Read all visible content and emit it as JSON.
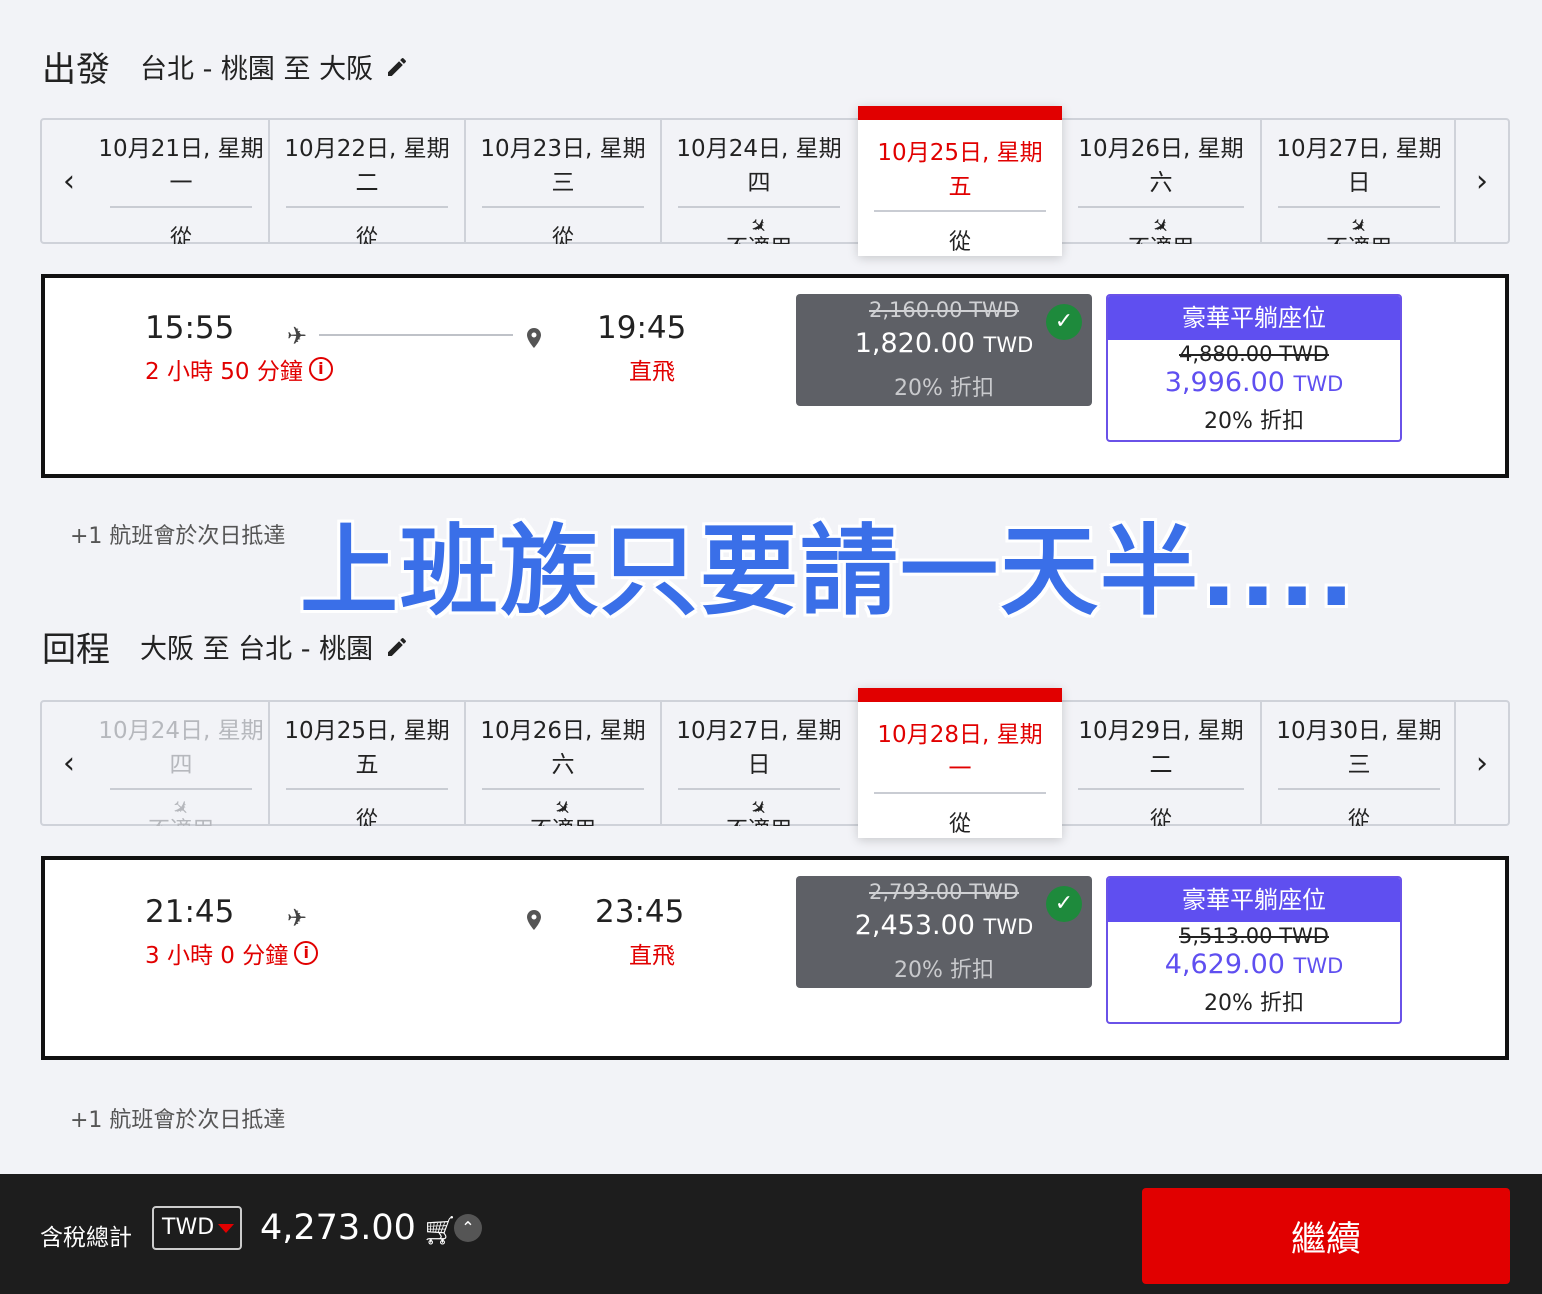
{
  "outbound": {
    "label": "出發",
    "route": "台北 - 桃園 至 大阪",
    "dates": [
      {
        "line1": "10月21日, 星期",
        "line2": "一",
        "status": "從"
      },
      {
        "line1": "10月22日, 星期",
        "line2": "二",
        "status": "從"
      },
      {
        "line1": "10月23日, 星期",
        "line2": "三",
        "status": "從"
      },
      {
        "line1": "10月24日, 星期",
        "line2": "四",
        "status": "不適用"
      },
      {
        "line1": "10月25日, 星期",
        "line2": "五",
        "status": "從"
      },
      {
        "line1": "10月26日, 星期",
        "line2": "六",
        "status": "不適用"
      },
      {
        "line1": "10月27日, 星期",
        "line2": "日",
        "status": "不適用"
      }
    ],
    "flight": {
      "depart": "15:55",
      "arrive": "19:45",
      "duration": "2 小時 50 分鐘",
      "type": "直飛",
      "standard": {
        "old": "2,160.00 TWD",
        "price": "1,820.00",
        "currency": "TWD",
        "discount": "20% 折扣"
      },
      "premium": {
        "title": "豪華平躺座位",
        "old": "4,880.00 TWD",
        "price": "3,996.00",
        "currency": "TWD",
        "discount": "20% 折扣"
      }
    },
    "note": "+1 航班會於次日抵達"
  },
  "overlay": "上班族只要請一天半....",
  "return": {
    "label": "回程",
    "route": "大阪 至 台北 - 桃園",
    "dates": [
      {
        "line1": "10月24日, 星期",
        "line2": "四",
        "status": "不適用"
      },
      {
        "line1": "10月25日, 星期",
        "line2": "五",
        "status": "從"
      },
      {
        "line1": "10月26日, 星期",
        "line2": "六",
        "status": "不適用"
      },
      {
        "line1": "10月27日, 星期",
        "line2": "日",
        "status": "不適用"
      },
      {
        "line1": "10月28日, 星期",
        "line2": "一",
        "status": "從"
      },
      {
        "line1": "10月29日, 星期",
        "line2": "二",
        "status": "從"
      },
      {
        "line1": "10月30日, 星期",
        "line2": "三",
        "status": "從"
      }
    ],
    "flight": {
      "depart": "21:45",
      "arrive": "23:45",
      "duration": "3 小時 0 分鐘",
      "type": "直飛",
      "standard": {
        "old": "2,793.00 TWD",
        "price": "2,453.00",
        "currency": "TWD",
        "discount": "20% 折扣"
      },
      "premium": {
        "title": "豪華平躺座位",
        "old": "5,513.00 TWD",
        "price": "4,629.00",
        "currency": "TWD",
        "discount": "20% 折扣"
      }
    },
    "note": "+1 航班會於次日抵達"
  },
  "footer": {
    "total_label": "含稅總計",
    "currency": "TWD",
    "total": "4,273.00",
    "continue": "繼續"
  },
  "colors": {
    "accent": "#e10000",
    "premium": "#5f4ff0",
    "selected_fare": "#5e6066",
    "overlay": "#3a6fe8"
  }
}
